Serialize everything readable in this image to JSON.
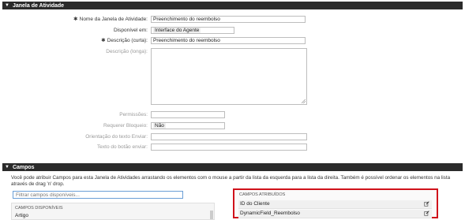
{
  "activity_window": {
    "section_title": "Janela de Atividade",
    "fields": {
      "name": {
        "label": "Nome da Janela de Atividade:",
        "value": "Preenchimento do reembolso"
      },
      "available_in": {
        "label": "Disponível em:",
        "value": "Interface do Agente"
      },
      "description_short": {
        "label": "Descrição (curta):",
        "value": "Preenchimento do reembolso"
      },
      "description_long": {
        "label": "Descrição (longa):",
        "value": ""
      },
      "permissions": {
        "label": "Permissões:",
        "value": ""
      },
      "require_lock": {
        "label": "Requerer Bloqueio:",
        "value": "Não"
      },
      "submit_advice": {
        "label": "Orientação do texto Enviar:",
        "value": ""
      },
      "submit_button_text": {
        "label": "Texto do botão enviar:",
        "value": ""
      }
    }
  },
  "fields_section": {
    "section_title": "Campos",
    "description": "Você pode atribuir Campos para esta Janela de Atividades arrastando os elementos com o mouse a partir da lista da esquerda para a lista da direita. Também é possível ordenar os elementos na lista através de drag 'n' drop.",
    "filter_placeholder": "Filtrar campos disponíveis...",
    "available": {
      "title": "CAMPOS DISPONÍVEIS",
      "items": [
        "Artigo"
      ]
    },
    "assigned": {
      "title": "CAMPOS ATRIBUÍDOS",
      "items": [
        "ID do Cliente",
        "DynamicField_Reembolso"
      ]
    }
  },
  "icons": {
    "collapse": "triangle-down-icon",
    "edit": "edit-icon"
  }
}
